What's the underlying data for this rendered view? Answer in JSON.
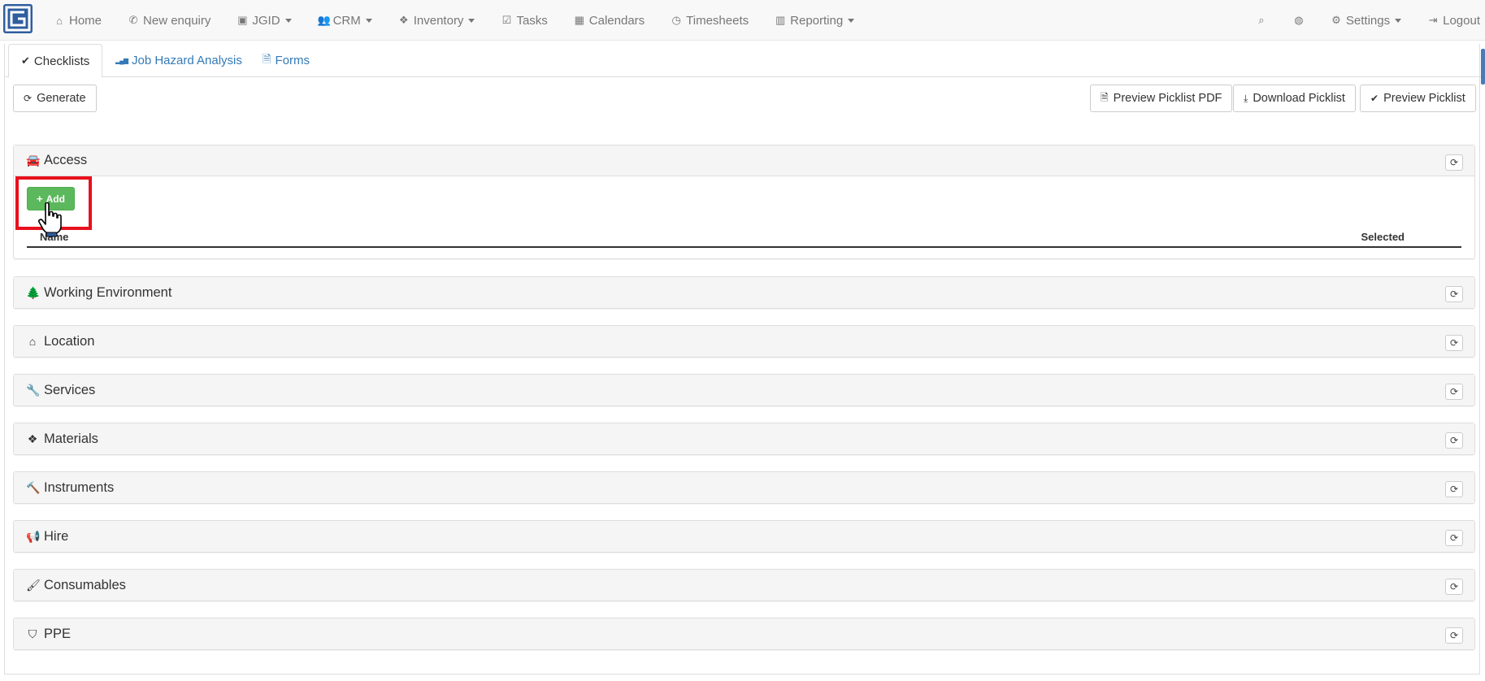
{
  "navbar": {
    "items": [
      {
        "icon": "home-icon",
        "glyph": "⌂",
        "label": "Home",
        "dropdown": false
      },
      {
        "icon": "phone-icon",
        "glyph": "✆",
        "label": "New enquiry",
        "dropdown": false
      },
      {
        "icon": "jgid-logo-icon",
        "glyph": "▣",
        "label": "JGID",
        "dropdown": true
      },
      {
        "icon": "users-icon",
        "glyph": "👥",
        "label": "CRM",
        "dropdown": true
      },
      {
        "icon": "cubes-icon",
        "glyph": "❖",
        "label": "Inventory",
        "dropdown": true
      },
      {
        "icon": "check-square-icon",
        "glyph": "☑",
        "label": "Tasks",
        "dropdown": false
      },
      {
        "icon": "calendar-icon",
        "glyph": "▦",
        "label": "Calendars",
        "dropdown": false
      },
      {
        "icon": "clock-icon",
        "glyph": "◷",
        "label": "Timesheets",
        "dropdown": false
      },
      {
        "icon": "bar-chart-icon",
        "glyph": "▥",
        "label": "Reporting",
        "dropdown": true
      }
    ],
    "right": {
      "search_glyph": "⌕",
      "globe_glyph": "◍",
      "settings_glyph": "⚙",
      "settings_label": "Settings",
      "logout_glyph": "⇥",
      "logout_label": "Logout"
    }
  },
  "tabs": [
    {
      "icon": "check-icon",
      "glyph": "✔",
      "label": "Checklists",
      "active": true
    },
    {
      "icon": "signal-icon",
      "glyph": "▂▄▆",
      "label": "Job Hazard Analysis",
      "active": false
    },
    {
      "icon": "file-icon",
      "glyph": "🗎",
      "label": "Forms",
      "active": false
    }
  ],
  "toolbar": {
    "generate_glyph": "⟳",
    "generate_label": "Generate",
    "preview_pdf_glyph": "🗎",
    "preview_pdf_label": "Preview Picklist PDF",
    "download_glyph": "⤓",
    "download_label": "Download Picklist",
    "preview_glyph": "✔",
    "preview_label": "Preview Picklist"
  },
  "sections": [
    {
      "icon": "car-icon",
      "glyph": "🚘",
      "title": "Access",
      "expanded": true
    },
    {
      "icon": "tree-icon",
      "glyph": "🌲",
      "title": "Working Environment",
      "expanded": false
    },
    {
      "icon": "home-icon",
      "glyph": "⌂",
      "title": "Location",
      "expanded": false
    },
    {
      "icon": "wrench-icon",
      "glyph": "🔧",
      "title": "Services",
      "expanded": false
    },
    {
      "icon": "cubes-icon",
      "glyph": "❖",
      "title": "Materials",
      "expanded": false
    },
    {
      "icon": "gavel-icon",
      "glyph": "🔨",
      "title": "Instruments",
      "expanded": false
    },
    {
      "icon": "bullhorn-icon",
      "glyph": "📢",
      "title": "Hire",
      "expanded": false
    },
    {
      "icon": "paint-brush-icon",
      "glyph": "🖌",
      "title": "Consumables",
      "expanded": false
    },
    {
      "icon": "shield-icon",
      "glyph": "⛉",
      "title": "PPE",
      "expanded": false
    }
  ],
  "refresh_glyph": "⟳",
  "access_body": {
    "add_label": "Add",
    "add_glyph": "+",
    "columns": {
      "name": "Name",
      "selected": "Selected"
    }
  },
  "colors": {
    "add_button": "#5cb85c",
    "highlight": "#e8101d",
    "link": "#337ab7",
    "logo": "#2f5d9e"
  }
}
